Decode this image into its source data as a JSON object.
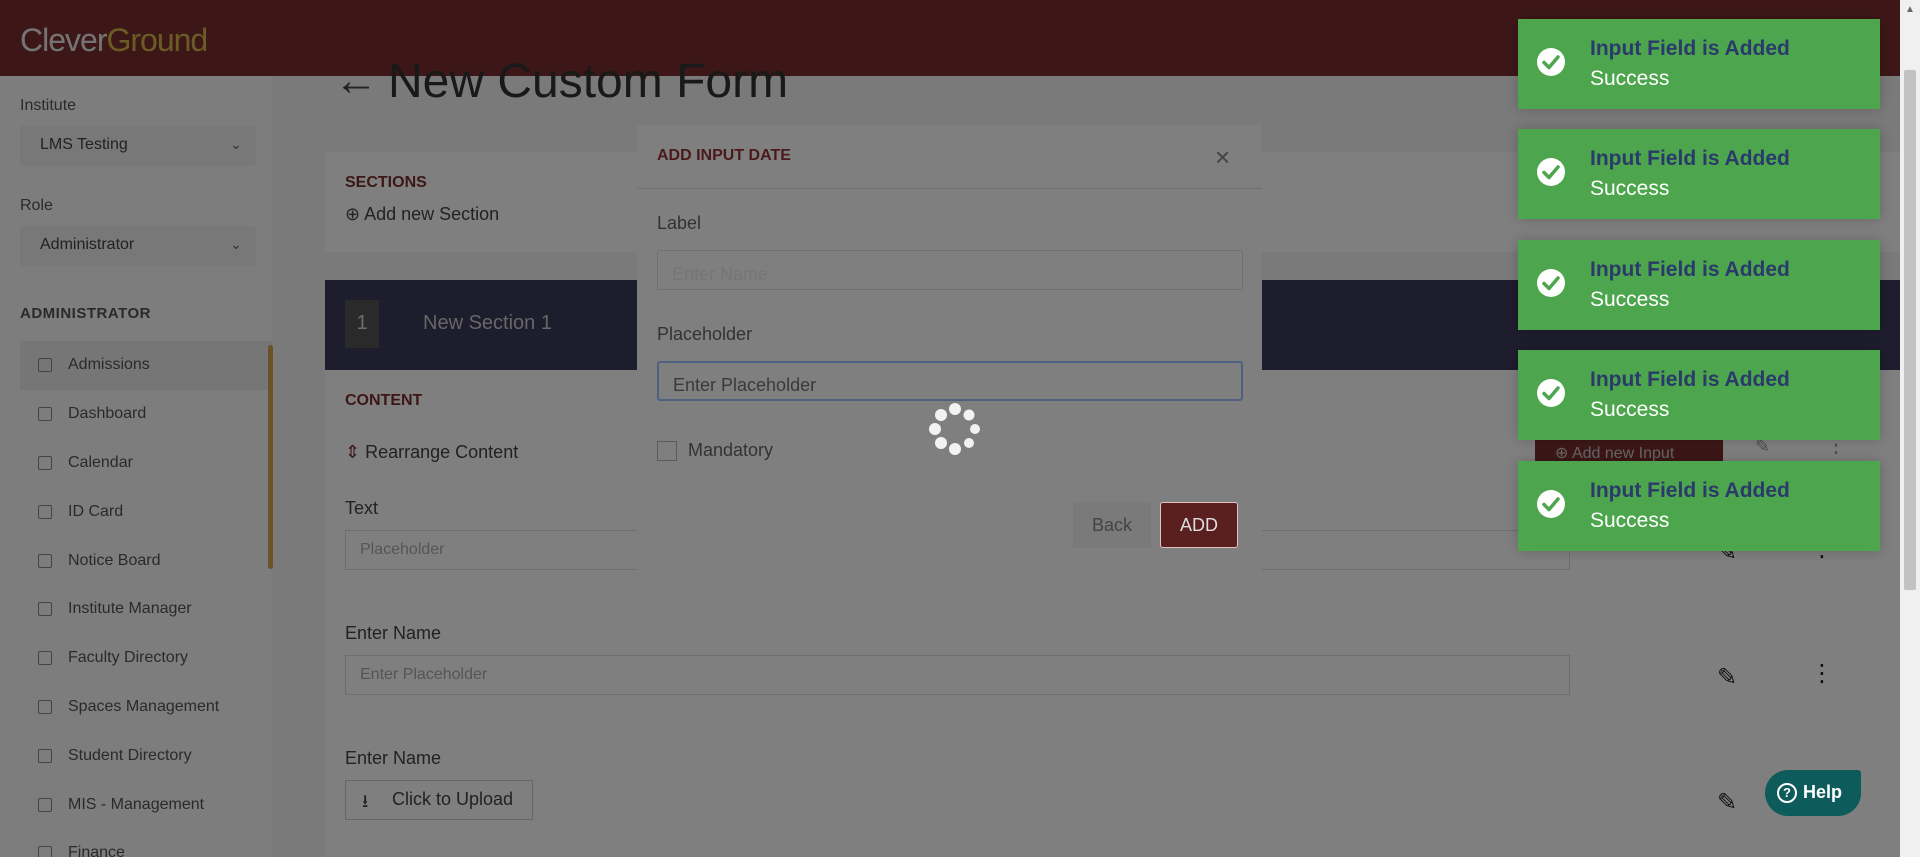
{
  "app": {
    "logo_part1": "Clever",
    "logo_part2": "Ground"
  },
  "sidebar": {
    "institute_label": "Institute",
    "institute_value": "LMS Testing",
    "role_label": "Role",
    "role_value": "Administrator",
    "section_heading": "ADMINISTRATOR",
    "items": [
      {
        "label": "Admissions",
        "icon": "document-icon"
      },
      {
        "label": "Dashboard",
        "icon": "chart-line-icon"
      },
      {
        "label": "Calendar",
        "icon": "calendar-icon"
      },
      {
        "label": "ID Card",
        "icon": "id-card-icon"
      },
      {
        "label": "Notice Board",
        "icon": "megaphone-icon"
      },
      {
        "label": "Institute Manager",
        "icon": "list-icon"
      },
      {
        "label": "Faculty Directory",
        "icon": "person-icon"
      },
      {
        "label": "Spaces Management",
        "icon": "building-icon"
      },
      {
        "label": "Student Directory",
        "icon": "person-icon"
      },
      {
        "label": "MIS - Management",
        "icon": "report-icon"
      },
      {
        "label": "Finance",
        "icon": "money-icon"
      }
    ]
  },
  "main": {
    "title": "New Custom Form",
    "sections_label": "SECTIONS",
    "add_section": "Add new Section",
    "section_number": "1",
    "section_name": "New Section 1",
    "content_label": "CONTENT",
    "rearrange": "Rearrange Content",
    "add_input": "Add new Input",
    "fields": [
      {
        "label": "Text",
        "placeholder": "Placeholder"
      },
      {
        "label": "Enter Name",
        "placeholder": "Enter Placeholder"
      },
      {
        "label": "Enter Name",
        "upload": "Click to Upload"
      }
    ]
  },
  "modal": {
    "title": "ADD INPUT DATE",
    "close": "×",
    "label_label": "Label",
    "label_placeholder": "Enter Name",
    "placeholder_label": "Placeholder",
    "placeholder_value": "Enter Placeholder",
    "mandatory": "Mandatory",
    "back": "Back",
    "add": "ADD"
  },
  "toasts": [
    {
      "title": "Input Field is Added",
      "message": "Success"
    },
    {
      "title": "Input Field is Added",
      "message": "Success"
    },
    {
      "title": "Input Field is Added",
      "message": "Success"
    },
    {
      "title": "Input Field is Added",
      "message": "Success"
    },
    {
      "title": "Input Field is Added",
      "message": "Success"
    }
  ],
  "help": {
    "label": "Help"
  },
  "colors": {
    "brand": "#7a2f2e",
    "accent": "#d6b84a",
    "toast": "#4da64d",
    "help": "#0d5b5b"
  }
}
